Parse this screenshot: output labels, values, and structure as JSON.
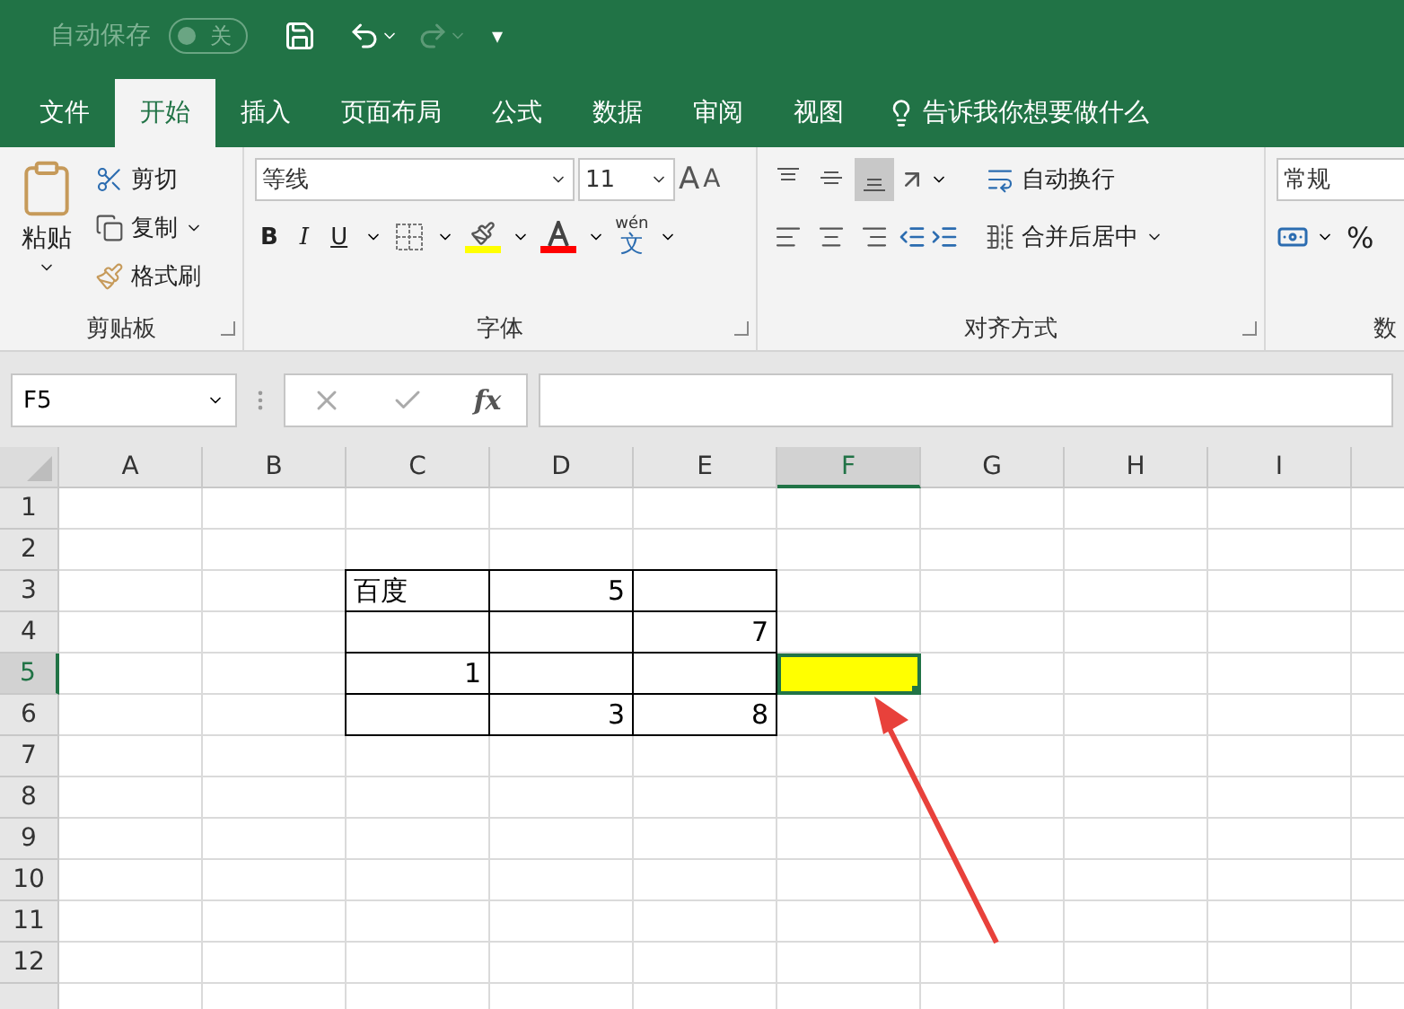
{
  "title_bar": {
    "autosave_label": "自动保存",
    "autosave_toggle": {
      "label": "关",
      "on": false
    },
    "customize_caret": "▾"
  },
  "tabs": [
    {
      "label": "文件",
      "selected": false
    },
    {
      "label": "开始",
      "selected": true
    },
    {
      "label": "插入",
      "selected": false
    },
    {
      "label": "页面布局",
      "selected": false
    },
    {
      "label": "公式",
      "selected": false
    },
    {
      "label": "数据",
      "selected": false
    },
    {
      "label": "审阅",
      "selected": false
    },
    {
      "label": "视图",
      "selected": false
    }
  ],
  "tell_me": {
    "placeholder": "告诉我你想要做什么"
  },
  "ribbon": {
    "clipboard": {
      "label": "剪贴板",
      "paste": "粘贴",
      "cut": "剪切",
      "copy": "复制",
      "format_painter": "格式刷"
    },
    "font": {
      "label": "字体",
      "font_name": "等线",
      "font_size": "11",
      "grow_font": "A",
      "shrink_font": "A",
      "bold": "B",
      "italic": "I",
      "underline": "U",
      "phonetic_top": "wén",
      "phonetic_bottom": "文"
    },
    "alignment": {
      "label": "对齐方式",
      "vertical": [
        {
          "kind": "top",
          "selected": false
        },
        {
          "kind": "middle",
          "selected": false
        },
        {
          "kind": "bottom",
          "selected": true
        }
      ],
      "horizontal": [
        {
          "kind": "left",
          "selected": false
        },
        {
          "kind": "center",
          "selected": false
        },
        {
          "kind": "right",
          "selected": false
        }
      ],
      "wrap_text": "自动换行",
      "merge": "合并后居中"
    },
    "number": {
      "label": "数",
      "format": "常规",
      "percent": "%"
    }
  },
  "formula_bar": {
    "name_box": "F5",
    "fx": "fx"
  },
  "sheet": {
    "columns": [
      {
        "label": "A",
        "selected": false
      },
      {
        "label": "B",
        "selected": false
      },
      {
        "label": "C",
        "selected": false
      },
      {
        "label": "D",
        "selected": false
      },
      {
        "label": "E",
        "selected": false
      },
      {
        "label": "F",
        "selected": true
      },
      {
        "label": "G",
        "selected": false
      },
      {
        "label": "H",
        "selected": false
      },
      {
        "label": "I",
        "selected": false
      }
    ],
    "rows": [
      {
        "label": "1",
        "selected": false,
        "cells": []
      },
      {
        "label": "2",
        "selected": false,
        "cells": []
      },
      {
        "label": "3",
        "selected": false,
        "cells": [
          null,
          null,
          {
            "kind": "text",
            "text": "百度",
            "bordered": true
          },
          {
            "kind": "number",
            "text": "5",
            "bordered": true
          },
          {
            "kind": "number",
            "bordered": true
          }
        ]
      },
      {
        "label": "4",
        "selected": false,
        "cells": [
          null,
          null,
          {
            "kind": "text",
            "bordered": true
          },
          {
            "kind": "number",
            "bordered": true
          },
          {
            "kind": "number",
            "text": "7",
            "bordered": true
          }
        ]
      },
      {
        "label": "5",
        "selected": true,
        "cells": [
          null,
          null,
          {
            "kind": "number",
            "text": "1",
            "bordered": true
          },
          {
            "kind": "number",
            "bordered": true
          },
          {
            "kind": "number",
            "bordered": true
          },
          {
            "kind": "text",
            "bordered": false,
            "active": true,
            "color": "#ffff00"
          }
        ]
      },
      {
        "label": "6",
        "selected": false,
        "cells": [
          null,
          null,
          {
            "kind": "text",
            "bordered": true
          },
          {
            "kind": "number",
            "text": "3",
            "bordered": true
          },
          {
            "kind": "number",
            "text": "8",
            "bordered": true
          }
        ]
      },
      {
        "label": "7",
        "selected": false,
        "cells": []
      },
      {
        "label": "8",
        "selected": false,
        "cells": []
      },
      {
        "label": "9",
        "selected": false,
        "cells": []
      },
      {
        "label": "10",
        "selected": false,
        "cells": []
      },
      {
        "label": "11",
        "selected": false,
        "cells": []
      },
      {
        "label": "12",
        "selected": false,
        "cells": []
      }
    ]
  }
}
